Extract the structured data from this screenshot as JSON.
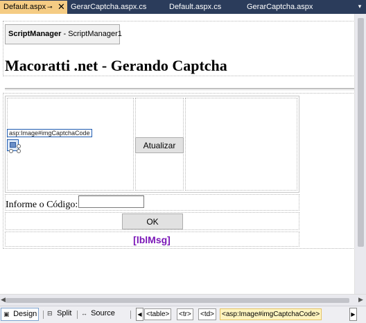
{
  "tabs": [
    {
      "label": "Default.aspx",
      "pin": "⊸",
      "close": "✕",
      "active": true
    },
    {
      "label": "GerarCaptcha.aspx.cs",
      "active": false
    },
    {
      "label": "Default.aspx.cs",
      "active": false
    },
    {
      "label": "GerarCaptcha.aspx",
      "active": false
    }
  ],
  "designer": {
    "script_manager": {
      "type": "ScriptManager",
      "id": "- ScriptManager1"
    },
    "page_title": "Macoratti .net - Gerando Captcha",
    "image_tag": "asp:Image#imgCaptchaCode",
    "refresh_button": "Atualizar",
    "code_label": "Informe o Código:",
    "code_input": "",
    "ok_button": "OK",
    "message_label": "[lblMsg]"
  },
  "view_tabs": [
    {
      "label": "Design",
      "icon": "design-view-icon",
      "active": true
    },
    {
      "label": "Split",
      "icon": "split-view-icon",
      "active": false
    },
    {
      "label": "Source",
      "icon": "source-view-icon",
      "active": false
    }
  ],
  "breadcrumb": [
    "<table>",
    "<tr>",
    "<td>",
    "<asp:Image#imgCaptchaCode>"
  ],
  "colors": {
    "tab_strip": "#2b3c5b",
    "active_tab": "#f5cc84",
    "message": "#7a16b7",
    "selection": "#1d5ab0"
  }
}
